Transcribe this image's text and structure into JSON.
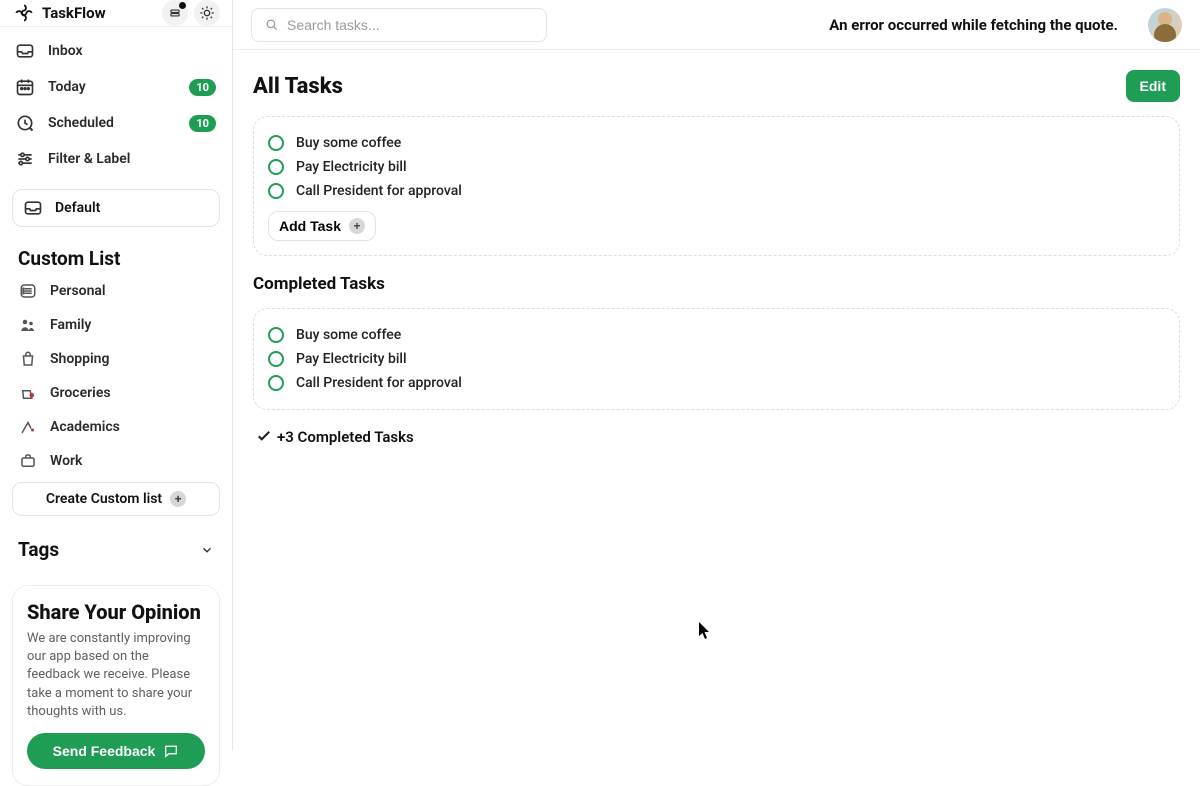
{
  "brand": {
    "name": "TaskFlow"
  },
  "topbar": {
    "search_placeholder": "Search tasks...",
    "error_text": "An error occurred while fetching the quote."
  },
  "sidebar": {
    "nav": [
      {
        "key": "inbox",
        "label": "Inbox",
        "icon": "inbox-icon",
        "badge": null
      },
      {
        "key": "today",
        "label": "Today",
        "icon": "calendar-icon",
        "badge": "10"
      },
      {
        "key": "scheduled",
        "label": "Scheduled",
        "icon": "clock-icon",
        "badge": "10"
      },
      {
        "key": "filter",
        "label": "Filter & Label",
        "icon": "sliders-icon",
        "badge": null
      }
    ],
    "default_label": "Default",
    "custom_list_title": "Custom List",
    "custom_lists": [
      {
        "label": "Personal",
        "icon": "list-icon"
      },
      {
        "label": "Family",
        "icon": "family-icon"
      },
      {
        "label": "Shopping",
        "icon": "bag-icon"
      },
      {
        "label": "Groceries",
        "icon": "groceries-icon"
      },
      {
        "label": "Academics",
        "icon": "academics-icon"
      },
      {
        "label": "Work",
        "icon": "briefcase-icon"
      }
    ],
    "create_custom_list_label": "Create Custom list",
    "tags_title": "Tags",
    "feedback": {
      "title": "Share Your Opinion",
      "body": "We are constantly improving our app based on the feedback we receive. Please take a moment to share your thoughts with us.",
      "button": "Send Feedback"
    }
  },
  "main": {
    "page_title": "All Tasks",
    "edit_label": "Edit",
    "tasks": [
      "Buy some coffee",
      "Pay Electricity bill",
      "Call President for approval"
    ],
    "add_task_label": "Add Task",
    "completed_title": "Completed Tasks",
    "completed_tasks": [
      "Buy some coffee",
      "Pay Electricity bill",
      "Call President for approval"
    ],
    "completed_summary": "+3 Completed Tasks"
  },
  "colors": {
    "accent": "#1f9d55"
  }
}
